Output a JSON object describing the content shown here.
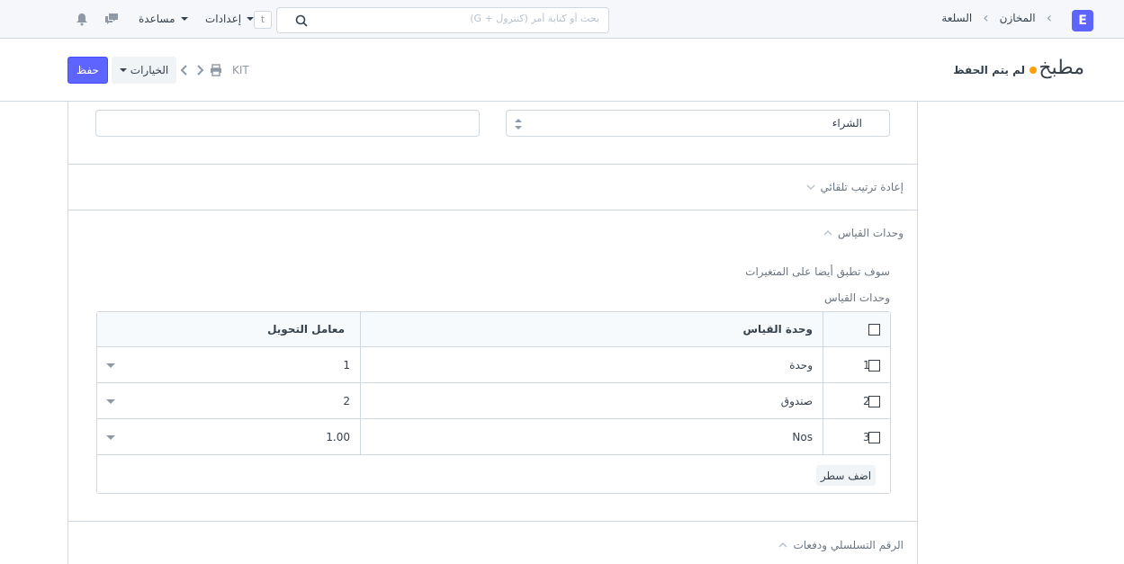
{
  "navbar": {
    "logo": "E",
    "breadcrumbs": [
      "المخازن",
      "السلعة"
    ],
    "search_placeholder": "بحث أو كتابة أمر (كنترول + G)",
    "kbd": "t",
    "settings_label": "إعدادات",
    "help_label": "مساعدة"
  },
  "page_head": {
    "title": "مطبخ",
    "status": "لم يتم الحفظ",
    "save_label": "حفظ",
    "options_label": "الخيارات",
    "doc_name": "KIT"
  },
  "form": {
    "select_value": "الشراء",
    "sections": {
      "auto_reorder": "إعادة ترتيب تلقائي",
      "uom": "وحدات القياس",
      "serial": "الرقم التسلسلي ودفعات"
    },
    "variants_note": "سوف تطبق أيضا على المتغيرات",
    "uom_table_label": "وحدات القياس"
  },
  "grid": {
    "columns": [
      "وحدة القياس",
      "معامل التحويل"
    ],
    "rows": [
      {
        "idx": "1",
        "uom": "وحدة",
        "factor": "1"
      },
      {
        "idx": "2",
        "uom": "صندوق",
        "factor": "2"
      },
      {
        "idx": "3",
        "uom": "Nos",
        "factor": "1.00"
      }
    ],
    "add_row_label": "اضف سطر"
  },
  "colors": {
    "primary": "#5e64ff",
    "indicator": "#ffa00a",
    "border": "#d1d8dd"
  }
}
